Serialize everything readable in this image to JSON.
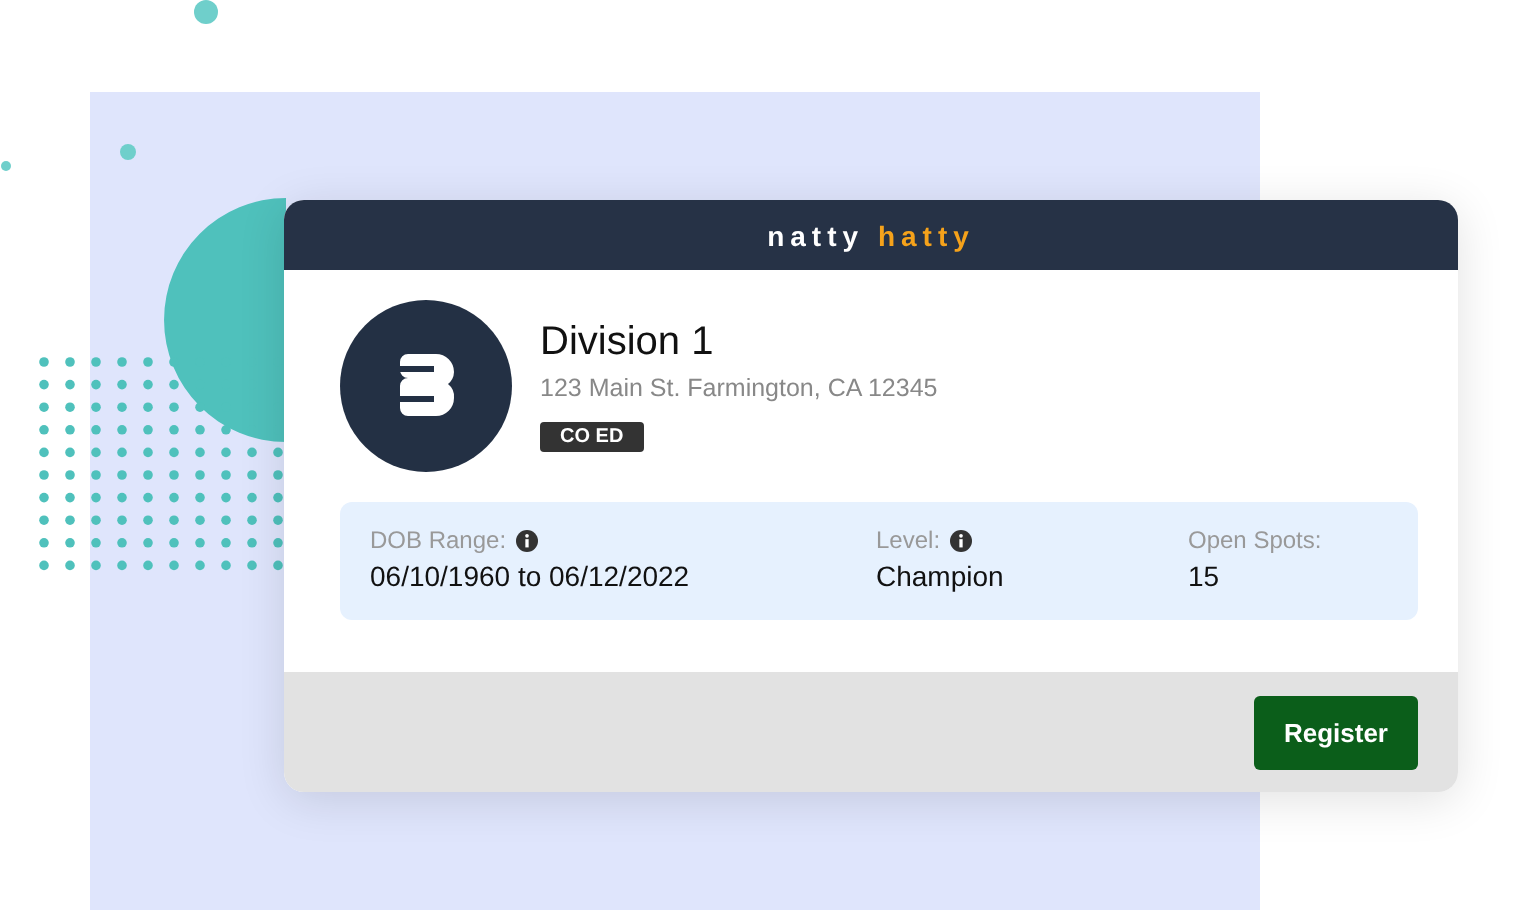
{
  "brand": {
    "first": "natty",
    "second": "hatty"
  },
  "division": {
    "name": "Division 1",
    "address": "123 Main St. Farmington, CA 12345",
    "tag": "CO ED"
  },
  "details": [
    {
      "label": "DOB Range:",
      "info": true,
      "value": "06/10/1960 to 06/12/2022"
    },
    {
      "label": "Level:",
      "info": true,
      "value": "Champion"
    },
    {
      "label": "Open Spots:",
      "info": false,
      "value": "15"
    }
  ],
  "actions": [
    "Register"
  ]
}
